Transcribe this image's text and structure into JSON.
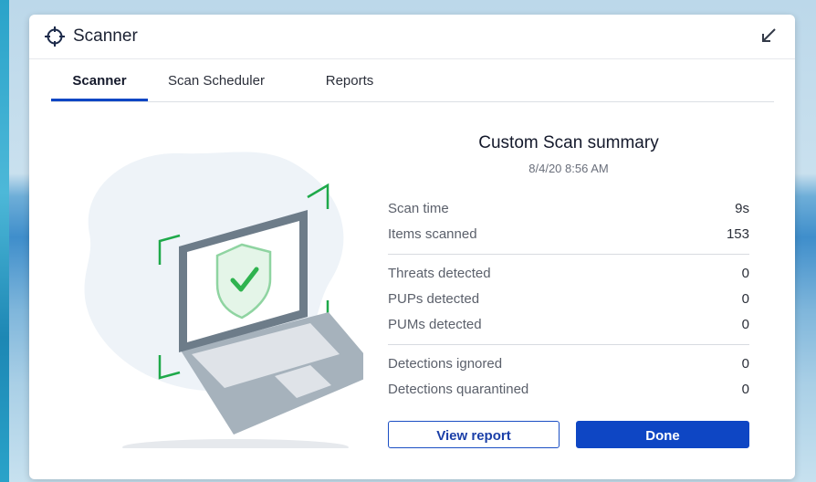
{
  "window": {
    "title": "Scanner",
    "icons": {
      "title": "crosshair-icon",
      "restore": "restore-arrow-icon"
    }
  },
  "tabs": [
    {
      "label": "Scanner",
      "active": true
    },
    {
      "label": "Scan Scheduler",
      "active": false
    },
    {
      "label": "Reports",
      "active": false
    }
  ],
  "summary": {
    "title": "Custom Scan summary",
    "date": "8/4/20 8:56 AM",
    "rows": [
      {
        "label": "Scan time",
        "value": "9s"
      },
      {
        "label": "Items scanned",
        "value": "153"
      },
      {
        "label": "Threats detected",
        "value": "0"
      },
      {
        "label": "PUPs detected",
        "value": "0"
      },
      {
        "label": "PUMs detected",
        "value": "0"
      },
      {
        "label": "Detections ignored",
        "value": "0"
      },
      {
        "label": "Detections quarantined",
        "value": "0"
      }
    ]
  },
  "buttons": {
    "view_report": "View report",
    "done": "Done"
  },
  "colors": {
    "accent": "#0e46c4",
    "shield_green": "#2fb34f",
    "frame_green": "#1ea94a"
  }
}
